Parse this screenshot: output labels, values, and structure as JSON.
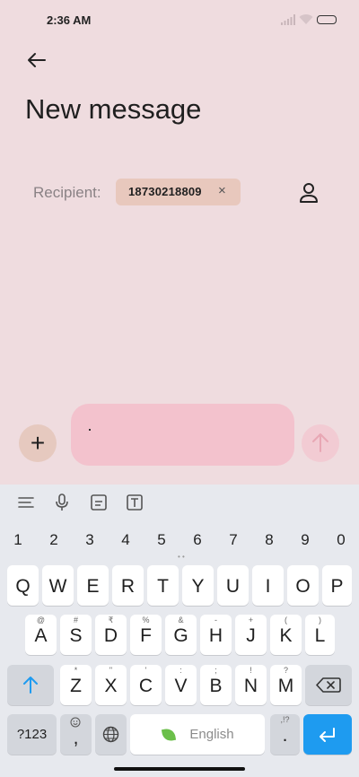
{
  "status": {
    "time": "2:36 AM"
  },
  "header": {
    "title": "New message"
  },
  "recipient": {
    "label": "Recipient:",
    "number": "18730218809",
    "remove": "×"
  },
  "composer": {
    "plus": "+"
  },
  "keyboard": {
    "numbers": [
      "1",
      "2",
      "3",
      "4",
      "5",
      "6",
      "7",
      "8",
      "9",
      "0"
    ],
    "row1": [
      "Q",
      "W",
      "E",
      "R",
      "T",
      "Y",
      "U",
      "I",
      "O",
      "P"
    ],
    "row2": [
      "A",
      "S",
      "D",
      "F",
      "G",
      "H",
      "J",
      "K",
      "L"
    ],
    "row2_sup": [
      "@",
      "#",
      "₹",
      "%",
      "&",
      "-",
      "+",
      "(",
      ")"
    ],
    "row3": [
      "Z",
      "X",
      "C",
      "V",
      "B",
      "N",
      "M"
    ],
    "row3_sup": [
      "*",
      "\"",
      "'",
      ":",
      ";",
      "!",
      "?"
    ],
    "sym_key": "?123",
    "comma": ",",
    "space_label": "English",
    "period": ".",
    "period_sup": ",!?"
  }
}
